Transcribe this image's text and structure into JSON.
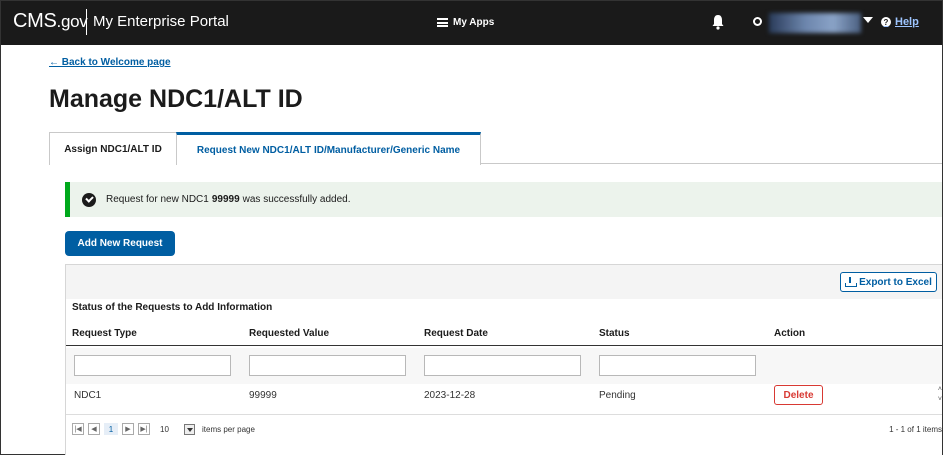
{
  "header": {
    "brand_main": "CMS",
    "brand_suffix": ".gov",
    "portal": "My Enterprise Portal",
    "my_apps": "My Apps",
    "help": "Help"
  },
  "back_link": "← Back to Welcome page",
  "page_title": "Manage NDC1/ALT ID",
  "tabs": [
    {
      "label": "Assign NDC1/ALT ID",
      "active": false
    },
    {
      "label": "Request New NDC1/ALT ID/Manufacturer/Generic Name",
      "active": true
    }
  ],
  "alert": {
    "prefix": "Request for new NDC1",
    "value": "99999",
    "suffix": "was successfully added."
  },
  "add_button": "Add New Request",
  "grid": {
    "export_label": "Export to Excel",
    "title": "Status of the Requests to Add Information",
    "columns": [
      "Request Type",
      "Requested Value",
      "Request Date",
      "Status",
      "Action"
    ],
    "rows": [
      {
        "type": "NDC1",
        "value": "99999",
        "date": "2023-12-28",
        "status": "Pending",
        "action": "Delete"
      }
    ],
    "pager": {
      "first": "|◀",
      "prev": "◀",
      "page": "1",
      "next": "▶",
      "last": "▶|",
      "page_size": "10",
      "per_page_label": "items per page",
      "info": "1 - 1 of 1 items"
    }
  },
  "colors": {
    "topbar": "#1a1a1a",
    "primary": "#005ea2",
    "success_bg": "#ecf3ec",
    "success_border": "#00a91c",
    "danger": "#d83933"
  }
}
